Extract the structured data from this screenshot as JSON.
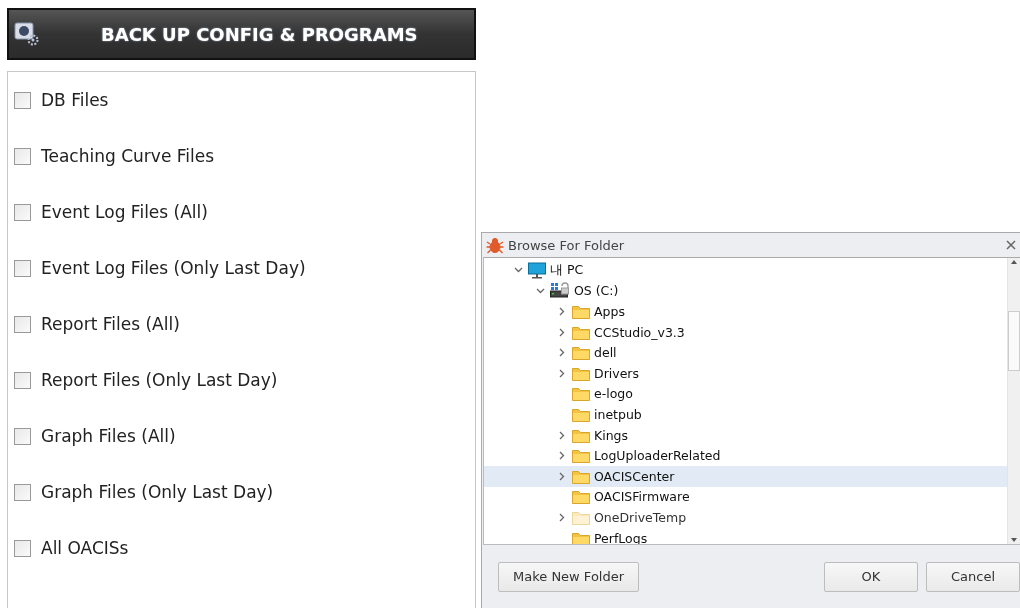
{
  "panel": {
    "title": "BACK UP CONFIG & PROGRAMS",
    "options": [
      {
        "label": "DB Files",
        "checked": false
      },
      {
        "label": "Teaching Curve Files",
        "checked": false
      },
      {
        "label": "Event Log Files (All)",
        "checked": false
      },
      {
        "label": "Event Log Files (Only Last Day)",
        "checked": false
      },
      {
        "label": "Report Files (All)",
        "checked": false
      },
      {
        "label": "Report Files (Only Last Day)",
        "checked": false
      },
      {
        "label": "Graph Files (All)",
        "checked": false
      },
      {
        "label": "Graph Files (Only Last Day)",
        "checked": false
      },
      {
        "label": "All OACISs",
        "checked": false
      }
    ]
  },
  "dialog": {
    "title": "Browse For Folder",
    "tree": [
      {
        "kind": "computer",
        "label": "내 PC",
        "expanded": true,
        "selected": false,
        "hidden": false,
        "children": [
          {
            "kind": "drive",
            "label": "OS (C:)",
            "expanded": true,
            "selected": false,
            "hidden": false,
            "children": [
              {
                "kind": "folder",
                "label": "Apps",
                "expandable": true,
                "expanded": false,
                "selected": false,
                "hidden": false
              },
              {
                "kind": "folder",
                "label": "CCStudio_v3.3",
                "expandable": true,
                "expanded": false,
                "selected": false,
                "hidden": false
              },
              {
                "kind": "folder",
                "label": "dell",
                "expandable": true,
                "expanded": false,
                "selected": false,
                "hidden": false
              },
              {
                "kind": "folder",
                "label": "Drivers",
                "expandable": true,
                "expanded": false,
                "selected": false,
                "hidden": false
              },
              {
                "kind": "folder",
                "label": "e-logo",
                "expandable": false,
                "expanded": false,
                "selected": false,
                "hidden": false
              },
              {
                "kind": "folder",
                "label": "inetpub",
                "expandable": false,
                "expanded": false,
                "selected": false,
                "hidden": false
              },
              {
                "kind": "folder",
                "label": "Kings",
                "expandable": true,
                "expanded": false,
                "selected": false,
                "hidden": false
              },
              {
                "kind": "folder",
                "label": "LogUploaderRelated",
                "expandable": true,
                "expanded": false,
                "selected": false,
                "hidden": false
              },
              {
                "kind": "folder",
                "label": "OACISCenter",
                "expandable": true,
                "expanded": false,
                "selected": true,
                "hidden": false
              },
              {
                "kind": "folder",
                "label": "OACISFirmware",
                "expandable": false,
                "expanded": false,
                "selected": false,
                "hidden": false
              },
              {
                "kind": "folder",
                "label": "OneDriveTemp",
                "expandable": true,
                "expanded": false,
                "selected": false,
                "hidden": true
              },
              {
                "kind": "folder",
                "label": "PerfLogs",
                "expandable": false,
                "expanded": false,
                "selected": false,
                "hidden": false
              }
            ]
          }
        ]
      }
    ],
    "buttons": [
      {
        "label": "Make New Folder"
      },
      {
        "label": "OK"
      },
      {
        "label": "Cancel"
      }
    ]
  }
}
